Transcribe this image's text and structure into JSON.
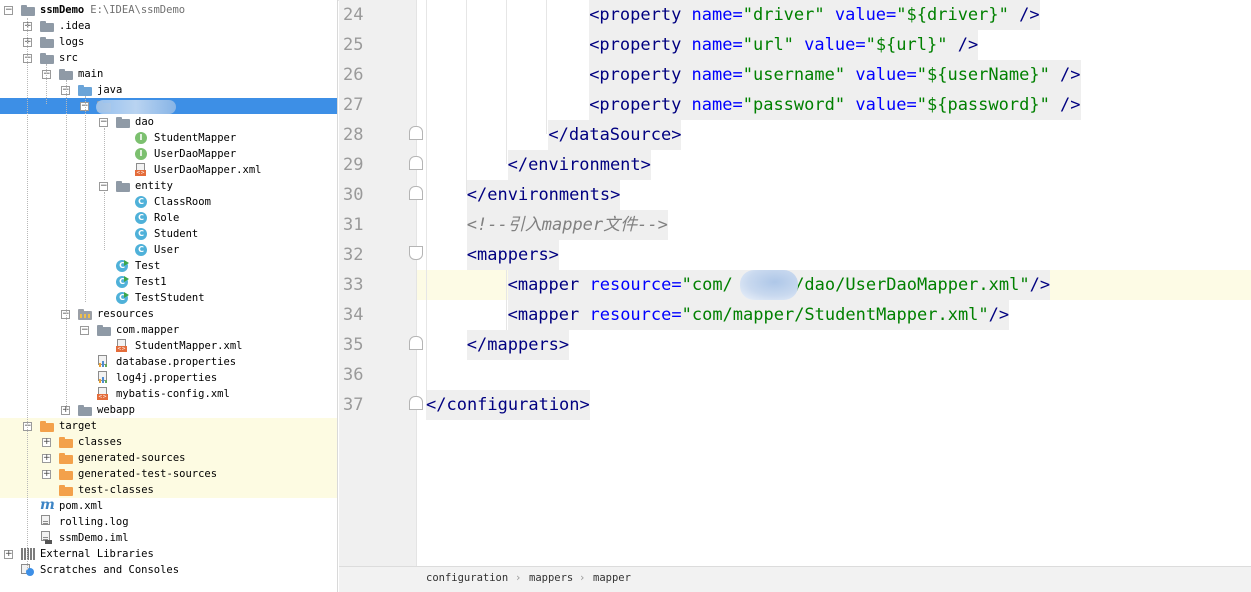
{
  "project": {
    "name": "ssmDemo",
    "path": "E:\\IDEA\\ssmDemo",
    "tree": [
      {
        "label": "ssmDemo",
        "path": "E:\\IDEA\\ssmDemo",
        "icon": "module-folder-icon",
        "toggle": "minus"
      },
      {
        "label": ".idea",
        "icon": "folder-icon",
        "toggle": "plus"
      },
      {
        "label": "logs",
        "icon": "folder-icon",
        "toggle": "plus"
      },
      {
        "label": "src",
        "icon": "folder-icon",
        "toggle": "minus"
      },
      {
        "label": "main",
        "icon": "folder-icon",
        "toggle": "minus"
      },
      {
        "label": "java",
        "icon": "source-folder-icon",
        "toggle": "minus"
      },
      {
        "label": "",
        "icon": "package-icon",
        "toggle": "minus"
      },
      {
        "label": "dao",
        "icon": "package-icon",
        "toggle": "minus"
      },
      {
        "label": "StudentMapper",
        "icon": "interface-icon"
      },
      {
        "label": "UserDaoMapper",
        "icon": "interface-icon"
      },
      {
        "label": "UserDaoMapper.xml",
        "icon": "xml-file-icon"
      },
      {
        "label": "entity",
        "icon": "package-icon",
        "toggle": "minus"
      },
      {
        "label": "ClassRoom",
        "icon": "class-icon"
      },
      {
        "label": "Role",
        "icon": "class-icon"
      },
      {
        "label": "Student",
        "icon": "class-icon"
      },
      {
        "label": "User",
        "icon": "class-icon"
      },
      {
        "label": "Test",
        "icon": "runnable-class-icon"
      },
      {
        "label": "Test1",
        "icon": "runnable-class-icon"
      },
      {
        "label": "TestStudent",
        "icon": "runnable-class-icon"
      },
      {
        "label": "resources",
        "icon": "resources-folder-icon",
        "toggle": "minus"
      },
      {
        "label": "com.mapper",
        "icon": "package-icon",
        "toggle": "minus"
      },
      {
        "label": "StudentMapper.xml",
        "icon": "xml-file-icon"
      },
      {
        "label": "database.properties",
        "icon": "properties-file-icon"
      },
      {
        "label": "log4j.properties",
        "icon": "properties-file-icon"
      },
      {
        "label": "mybatis-config.xml",
        "icon": "xml-file-icon"
      },
      {
        "label": "webapp",
        "icon": "folder-icon",
        "toggle": "plus"
      },
      {
        "label": "target",
        "icon": "excluded-folder-icon",
        "toggle": "minus"
      },
      {
        "label": "classes",
        "icon": "excluded-folder-icon",
        "toggle": "plus"
      },
      {
        "label": "generated-sources",
        "icon": "excluded-folder-icon",
        "toggle": "plus"
      },
      {
        "label": "generated-test-sources",
        "icon": "excluded-folder-icon",
        "toggle": "plus"
      },
      {
        "label": "test-classes",
        "icon": "excluded-folder-icon"
      },
      {
        "label": "pom.xml",
        "icon": "maven-icon"
      },
      {
        "label": "rolling.log",
        "icon": "text-file-icon"
      },
      {
        "label": "ssmDemo.iml",
        "icon": "iml-file-icon"
      },
      {
        "label": "External Libraries",
        "icon": "libraries-icon",
        "toggle": "plus"
      },
      {
        "label": "Scratches and Consoles",
        "icon": "scratches-icon"
      }
    ]
  },
  "editor": {
    "current_line": "33",
    "lines": [
      {
        "num": "24",
        "parts": [
          [
            "tg",
            "<property"
          ],
          [
            "an",
            " name="
          ],
          [
            "av",
            "\"driver\""
          ],
          [
            "an",
            " value="
          ],
          [
            "av",
            "\"${driver}\""
          ],
          [
            "tg",
            " />"
          ]
        ]
      },
      {
        "num": "25",
        "parts": [
          [
            "tg",
            "<property"
          ],
          [
            "an",
            " name="
          ],
          [
            "av",
            "\"url\""
          ],
          [
            "an",
            " value="
          ],
          [
            "av",
            "\"${url}\""
          ],
          [
            "tg",
            " />"
          ]
        ]
      },
      {
        "num": "26",
        "parts": [
          [
            "tg",
            "<property"
          ],
          [
            "an",
            " name="
          ],
          [
            "av",
            "\"username\""
          ],
          [
            "an",
            " value="
          ],
          [
            "av",
            "\"${userName}\""
          ],
          [
            "tg",
            " />"
          ]
        ]
      },
      {
        "num": "27",
        "parts": [
          [
            "tg",
            "<property"
          ],
          [
            "an",
            " name="
          ],
          [
            "av",
            "\"password\""
          ],
          [
            "an",
            " value="
          ],
          [
            "av",
            "\"${password}\""
          ],
          [
            "tg",
            " />"
          ]
        ]
      },
      {
        "num": "28",
        "parts": [
          [
            "tg",
            "</dataSource>"
          ]
        ]
      },
      {
        "num": "29",
        "parts": [
          [
            "tg",
            "</environment>"
          ]
        ]
      },
      {
        "num": "30",
        "parts": [
          [
            "tg",
            "</environments>"
          ]
        ]
      },
      {
        "num": "31",
        "parts": [
          [
            "cm",
            "<!--引入mapper文件-->"
          ]
        ]
      },
      {
        "num": "32",
        "parts": [
          [
            "tg",
            "<mappers>"
          ]
        ]
      },
      {
        "num": "33",
        "parts": [
          [
            "tg",
            "<mapper"
          ],
          [
            "an",
            " resource="
          ],
          [
            "av",
            "\"com/      /dao/UserDaoMapper.xml\""
          ],
          [
            "tg",
            "/>"
          ]
        ]
      },
      {
        "num": "34",
        "parts": [
          [
            "tg",
            "<mapper"
          ],
          [
            "an",
            " resource="
          ],
          [
            "av",
            "\"com/mapper/StudentMapper.xml\""
          ],
          [
            "tg",
            "/>"
          ]
        ]
      },
      {
        "num": "35",
        "parts": [
          [
            "tg",
            "</mappers>"
          ]
        ]
      },
      {
        "num": "36",
        "parts": []
      },
      {
        "num": "37",
        "parts": [
          [
            "tg",
            "</configuration>"
          ]
        ]
      }
    ]
  },
  "breadcrumb": [
    "configuration",
    "mappers",
    "mapper"
  ],
  "colors": {
    "selection": "#3d8fe6",
    "tag": "#000080",
    "attr_name": "#0000ff",
    "attr_value": "#008000",
    "comment": "#808080",
    "current_line": "#fdfbe5"
  }
}
